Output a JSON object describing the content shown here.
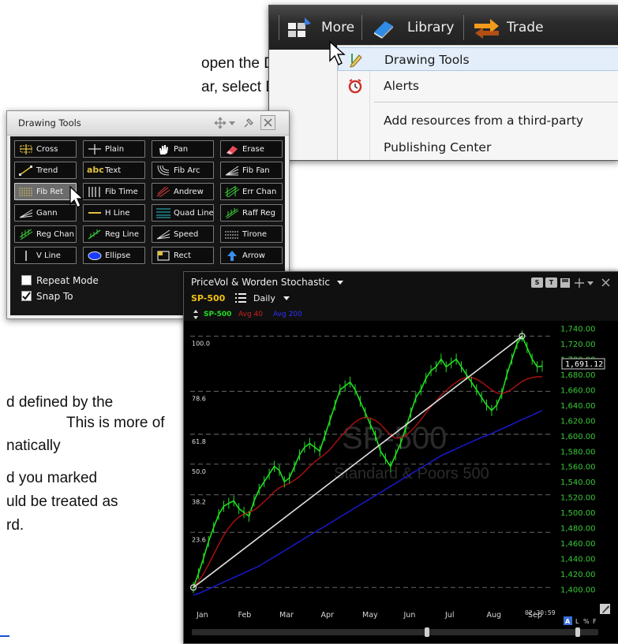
{
  "background_text": {
    "line1": "open the Drawing Tools",
    "line2": "ar, select Drawing Tools.",
    "line3": "d defined by the",
    "line4": "This is more of",
    "line5": "natically",
    "line6": "d you marked",
    "line7": "uld be treated as",
    "line8": "rd."
  },
  "menu": {
    "bar": {
      "more": "More",
      "library": "Library",
      "trade": "Trade"
    },
    "items": [
      {
        "label": "Drawing Tools",
        "icon": "pencil-icon",
        "highlighted": true
      },
      {
        "label": "Alerts",
        "icon": "alarm-clock-icon"
      },
      {
        "label": "Add resources from a third-party"
      },
      {
        "label": "Publishing Center"
      }
    ]
  },
  "drawing_tools": {
    "title": "Drawing Tools",
    "tools": [
      [
        "Cross",
        "Plain",
        "Pan",
        "Erase"
      ],
      [
        "Trend",
        "Text",
        "Fib Arc",
        "Fib Fan"
      ],
      [
        "Fib Ret",
        "Fib Time",
        "Andrew",
        "Err Chan"
      ],
      [
        "Gann",
        "H Line",
        "Quad Line",
        "Raff Reg"
      ],
      [
        "Reg Chan",
        "Reg Line",
        "Speed",
        "Tirone"
      ],
      [
        "V Line",
        "Ellipse",
        "Rect",
        "Arrow"
      ]
    ],
    "selected_tool": "Fib Ret",
    "text_icon_label": "abc",
    "options": [
      {
        "label": "Repeat Mode",
        "checked": false
      },
      {
        "label": "Snap To",
        "checked": true
      }
    ]
  },
  "chart": {
    "title": "PriceVol & Worden Stochastic",
    "symbol": "SP-500",
    "period": "Daily",
    "legend": {
      "symbol": "SP-500",
      "avg1": "Avg 40",
      "avg2": "Avg 200"
    },
    "watermark_symbol": "SP-500",
    "watermark_name": "Standard & Poors 500",
    "price_readout": "1,691.12",
    "time": "02:30:59",
    "footer_toggles": [
      "A",
      "L",
      "%",
      "F"
    ],
    "colors": {
      "price": "#22dd22",
      "avg40": "#b01010",
      "avg200": "#1a1ad8",
      "axis_text": "#3ac83a",
      "trend": "#e0e0e0"
    }
  },
  "chart_data": {
    "type": "line",
    "x_labels": [
      "Jan",
      "Feb",
      "Mar",
      "Apr",
      "May",
      "Jun",
      "Jul",
      "Aug",
      "Sep"
    ],
    "y_ticks": [
      1740,
      1720,
      1700,
      1680,
      1660,
      1640,
      1620,
      1600,
      1580,
      1560,
      1540,
      1520,
      1500,
      1480,
      1460,
      1440,
      1420,
      1400
    ],
    "y_tick_labels": [
      "1,740.00",
      "1,720.00",
      "1,700.00",
      "1,680.00",
      "1,660.00",
      "1,640.00",
      "1,620.00",
      "1,600.00",
      "1,580.00",
      "1,560.00",
      "1,540.00",
      "1,520.00",
      "1,500.00",
      "1,480.00",
      "1,460.00",
      "1,440.00",
      "1,420.00",
      "1,400.00"
    ],
    "ylim": [
      1390,
      1750
    ],
    "fib_levels": [
      {
        "label": "100.0",
        "value": 1730
      },
      {
        "label": "78.6",
        "value": 1658
      },
      {
        "label": "61.8",
        "value": 1602
      },
      {
        "label": "50.0",
        "value": 1563
      },
      {
        "label": "38.2",
        "value": 1523
      },
      {
        "label": "23.6",
        "value": 1474
      },
      {
        "label": "",
        "value": 1402
      }
    ],
    "series": [
      {
        "name": "SP-500",
        "values": [
          1402,
          1420,
          1440,
          1462,
          1480,
          1497,
          1508,
          1512,
          1515,
          1505,
          1500,
          1495,
          1515,
          1530,
          1540,
          1550,
          1560,
          1555,
          1540,
          1545,
          1560,
          1575,
          1585,
          1590,
          1585,
          1580,
          1600,
          1620,
          1640,
          1660,
          1665,
          1670,
          1660,
          1645,
          1630,
          1615,
          1600,
          1580,
          1570,
          1560,
          1575,
          1590,
          1610,
          1630,
          1650,
          1660,
          1675,
          1685,
          1690,
          1700,
          1690,
          1695,
          1700,
          1690,
          1680,
          1670,
          1660,
          1650,
          1640,
          1633,
          1640,
          1655,
          1680,
          1700,
          1720,
          1730,
          1715,
          1700,
          1690,
          1691
        ]
      },
      {
        "name": "Avg 40",
        "values": [
          1402,
          1410,
          1420,
          1432,
          1445,
          1458,
          1470,
          1480,
          1488,
          1494,
          1498,
          1500,
          1503,
          1508,
          1514,
          1520,
          1527,
          1532,
          1535,
          1538,
          1542,
          1547,
          1553,
          1560,
          1566,
          1571,
          1576,
          1582,
          1590,
          1598,
          1605,
          1612,
          1618,
          1622,
          1624,
          1623,
          1620,
          1615,
          1608,
          1601,
          1597,
          1597,
          1600,
          1606,
          1613,
          1621,
          1630,
          1638,
          1645,
          1653,
          1659,
          1665,
          1670,
          1674,
          1676,
          1676,
          1674,
          1670,
          1665,
          1660,
          1656,
          1655,
          1657,
          1661,
          1666,
          1671,
          1674,
          1676,
          1677,
          1677
        ]
      },
      {
        "name": "Avg 200",
        "values": [
          1392,
          1394,
          1397,
          1400,
          1403,
          1406,
          1409,
          1412,
          1415,
          1418,
          1421,
          1424,
          1427,
          1430,
          1434,
          1438,
          1442,
          1446,
          1450,
          1454,
          1458,
          1462,
          1466,
          1470,
          1474,
          1478,
          1482,
          1486,
          1490,
          1494,
          1498,
          1502,
          1506,
          1510,
          1514,
          1518,
          1522,
          1526,
          1530,
          1534,
          1538,
          1542,
          1546,
          1550,
          1554,
          1558,
          1562,
          1566,
          1570,
          1574,
          1577,
          1580,
          1583,
          1586,
          1589,
          1592,
          1595,
          1598,
          1600,
          1603,
          1606,
          1609,
          1612,
          1615,
          1618,
          1621,
          1624,
          1627,
          1630,
          1633
        ]
      }
    ]
  }
}
